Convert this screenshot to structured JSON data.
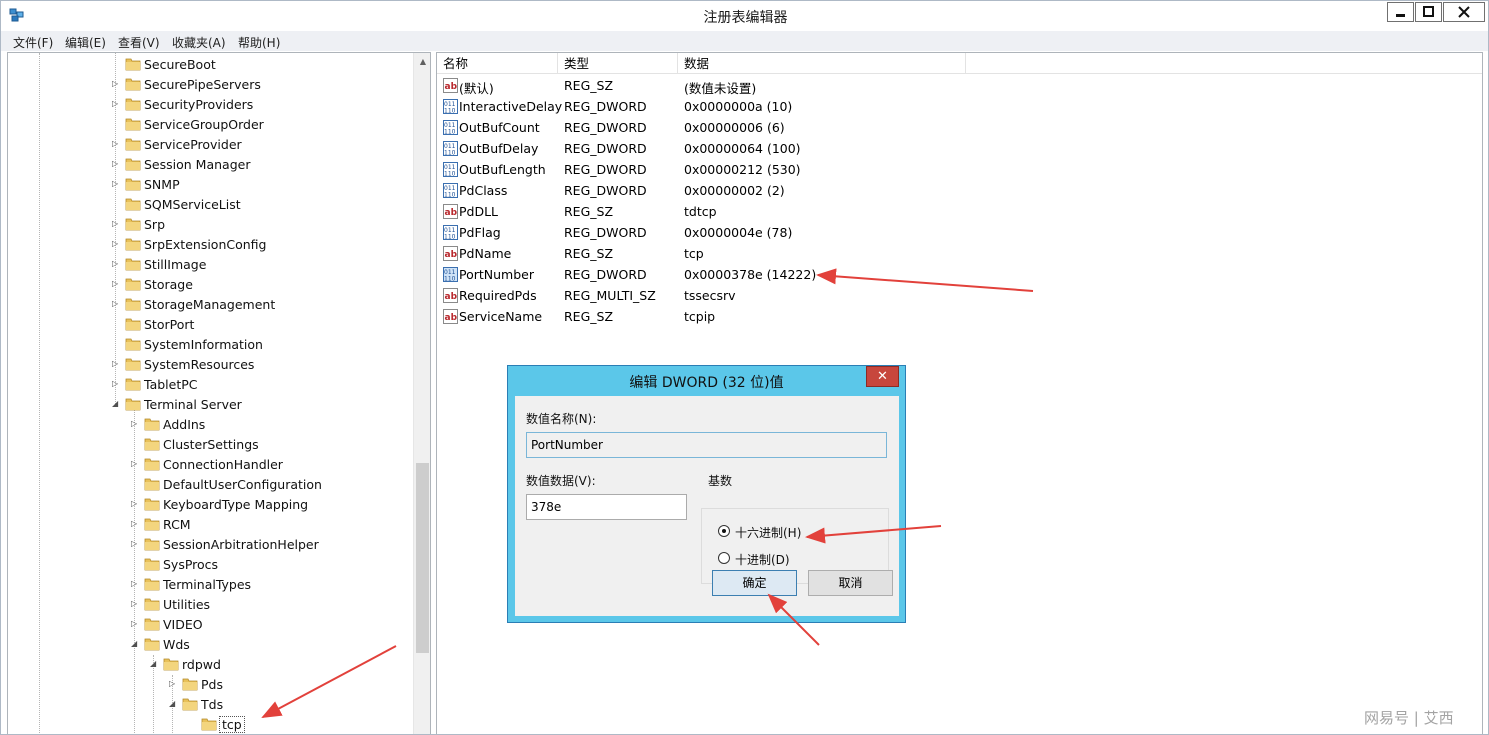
{
  "window": {
    "title": "注册表编辑器"
  },
  "menu": [
    "文件(F)",
    "编辑(E)",
    "查看(V)",
    "收藏夹(A)",
    "帮助(H)"
  ],
  "tree": [
    {
      "label": "SecureBoot",
      "level": 0,
      "expander": ""
    },
    {
      "label": "SecurePipeServers",
      "level": 0,
      "expander": "closed"
    },
    {
      "label": "SecurityProviders",
      "level": 0,
      "expander": "closed"
    },
    {
      "label": "ServiceGroupOrder",
      "level": 0,
      "expander": ""
    },
    {
      "label": "ServiceProvider",
      "level": 0,
      "expander": "closed"
    },
    {
      "label": "Session Manager",
      "level": 0,
      "expander": "closed"
    },
    {
      "label": "SNMP",
      "level": 0,
      "expander": "closed"
    },
    {
      "label": "SQMServiceList",
      "level": 0,
      "expander": ""
    },
    {
      "label": "Srp",
      "level": 0,
      "expander": "closed"
    },
    {
      "label": "SrpExtensionConfig",
      "level": 0,
      "expander": "closed"
    },
    {
      "label": "StillImage",
      "level": 0,
      "expander": "closed"
    },
    {
      "label": "Storage",
      "level": 0,
      "expander": "closed"
    },
    {
      "label": "StorageManagement",
      "level": 0,
      "expander": "closed"
    },
    {
      "label": "StorPort",
      "level": 0,
      "expander": ""
    },
    {
      "label": "SystemInformation",
      "level": 0,
      "expander": ""
    },
    {
      "label": "SystemResources",
      "level": 0,
      "expander": "closed"
    },
    {
      "label": "TabletPC",
      "level": 0,
      "expander": "closed"
    },
    {
      "label": "Terminal Server",
      "level": 0,
      "expander": "open"
    },
    {
      "label": "AddIns",
      "level": 1,
      "expander": "closed"
    },
    {
      "label": "ClusterSettings",
      "level": 1,
      "expander": ""
    },
    {
      "label": "ConnectionHandler",
      "level": 1,
      "expander": "closed"
    },
    {
      "label": "DefaultUserConfiguration",
      "level": 1,
      "expander": ""
    },
    {
      "label": "KeyboardType Mapping",
      "level": 1,
      "expander": "closed"
    },
    {
      "label": "RCM",
      "level": 1,
      "expander": "closed"
    },
    {
      "label": "SessionArbitrationHelper",
      "level": 1,
      "expander": "closed"
    },
    {
      "label": "SysProcs",
      "level": 1,
      "expander": ""
    },
    {
      "label": "TerminalTypes",
      "level": 1,
      "expander": "closed"
    },
    {
      "label": "Utilities",
      "level": 1,
      "expander": "closed"
    },
    {
      "label": "VIDEO",
      "level": 1,
      "expander": "closed"
    },
    {
      "label": "Wds",
      "level": 1,
      "expander": "open"
    },
    {
      "label": "rdpwd",
      "level": 2,
      "expander": "open"
    },
    {
      "label": "Pds",
      "level": 3,
      "expander": "closed"
    },
    {
      "label": "Tds",
      "level": 3,
      "expander": "open"
    },
    {
      "label": "tcp",
      "level": 4,
      "expander": "",
      "selected": true
    }
  ],
  "list": {
    "headers": [
      "名称",
      "类型",
      "数据"
    ],
    "rows": [
      {
        "name": "(默认)",
        "type": "REG_SZ",
        "data": "(数值未设置)",
        "icon": "string-value-icon"
      },
      {
        "name": "InteractiveDelay",
        "type": "REG_DWORD",
        "data": "0x0000000a (10)",
        "icon": "binary-value-icon"
      },
      {
        "name": "OutBufCount",
        "type": "REG_DWORD",
        "data": "0x00000006 (6)",
        "icon": "binary-value-icon"
      },
      {
        "name": "OutBufDelay",
        "type": "REG_DWORD",
        "data": "0x00000064 (100)",
        "icon": "binary-value-icon"
      },
      {
        "name": "OutBufLength",
        "type": "REG_DWORD",
        "data": "0x00000212 (530)",
        "icon": "binary-value-icon"
      },
      {
        "name": "PdClass",
        "type": "REG_DWORD",
        "data": "0x00000002 (2)",
        "icon": "binary-value-icon"
      },
      {
        "name": "PdDLL",
        "type": "REG_SZ",
        "data": "tdtcp",
        "icon": "string-value-icon"
      },
      {
        "name": "PdFlag",
        "type": "REG_DWORD",
        "data": "0x0000004e (78)",
        "icon": "binary-value-icon"
      },
      {
        "name": "PdName",
        "type": "REG_SZ",
        "data": "tcp",
        "icon": "string-value-icon"
      },
      {
        "name": "PortNumber",
        "type": "REG_DWORD",
        "data": "0x0000378e (14222)",
        "icon": "binary-value-icon",
        "highlight": true
      },
      {
        "name": "RequiredPds",
        "type": "REG_MULTI_SZ",
        "data": "tssecsrv",
        "icon": "string-value-icon"
      },
      {
        "name": "ServiceName",
        "type": "REG_SZ",
        "data": "tcpip",
        "icon": "string-value-icon"
      }
    ]
  },
  "dialog": {
    "title": "编辑 DWORD (32 位)值",
    "close": "✕",
    "name_label": "数值名称(N):",
    "name_value": "PortNumber",
    "data_label": "数值数据(V):",
    "data_value": "378e",
    "base_label": "基数",
    "hex_label": "十六进制(H)",
    "dec_label": "十进制(D)",
    "hex_selected": true,
    "ok": "确定",
    "cancel": "取消"
  },
  "watermark": "网易号 | 艾西",
  "colors": {
    "dialog_frame": "#5bc7e9",
    "close_red": "#c7463d",
    "arrow": "#e2413b",
    "folder": "#e8c15a"
  }
}
